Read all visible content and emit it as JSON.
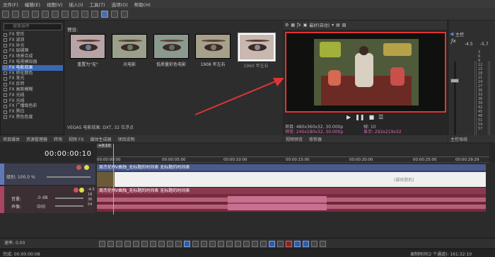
{
  "menu": [
    "文件(F)",
    "编辑(E)",
    "视图(V)",
    "插入(I)",
    "工具(T)",
    "选项(O)",
    "帮助(H)"
  ],
  "fx": {
    "search_placeholder": "搜索插件",
    "items": [
      "变形",
      "波浪",
      "补光",
      "层缝隙",
      "场景合成",
      "电视模拟器",
      "电影效果",
      "转化颜色",
      "发光",
      "反转",
      "高斯模糊",
      "光线",
      "光线",
      "广播级色彩",
      "黑白",
      "黑色色度"
    ],
    "selected_index": 6
  },
  "presets": {
    "label": "预设:",
    "items": [
      "重置为\"无\"",
      "光电影",
      "低质量彩色电影",
      "1908 年左右",
      "1960 年左右"
    ],
    "status": "VEGAS 电影效果: DXT, 32 位浮点"
  },
  "tabs": {
    "left": [
      "项目媒体",
      "资源管理器",
      "转场",
      "视频 FX",
      "媒体生成器",
      "项目说明"
    ],
    "preview": [
      "视频预览",
      "修剪器"
    ],
    "master": [
      "主控母线"
    ]
  },
  "preview": {
    "mode": "最好(自动)",
    "info_left": [
      "项目: 480x360x32, 30.000p",
      "预览: 240x180x32, 30.000p",
      "显示: 292x219x32"
    ],
    "info_right": [
      "帧:",
      "10"
    ],
    "pink_key": "预览: 240x180x32, 30.000p"
  },
  "master": {
    "title": "主控",
    "levels": [
      "-4.5",
      "-5.7"
    ],
    "scale": [
      "3",
      "6",
      "9",
      "12",
      "15",
      "18",
      "21",
      "24",
      "27",
      "30",
      "33",
      "36",
      "39",
      "42",
      "45",
      "48",
      "51",
      "54",
      "57"
    ]
  },
  "timeline": {
    "current_time": "00:00:00:10",
    "marker": "+0:10",
    "ruler_ticks": [
      "00:00:00:00",
      "00:00:05:00",
      "00:00:10:00",
      "00:00:15:00",
      "00:00:20:00",
      "00:00:25:00",
      "00:00:29:29"
    ],
    "video_track": {
      "label": "级别: 100.0 %",
      "clip_title": "周杰伦MV曲独_无标题的时间表 无标题的时间表",
      "media_offline": "(媒体脱机)"
    },
    "audio_track": {
      "volume_label": "音量:",
      "volume_value": ".0 dB",
      "pan_label": "声像:",
      "pan_value": "中间",
      "clip_title": "周杰伦MV曲独_无标题的时间表 无标题的时间表",
      "meter": [
        "-4.5",
        "18",
        "36",
        "54"
      ]
    },
    "rate_label": "速率:",
    "rate_value": "0.00"
  },
  "status": {
    "left": "完成: 00:00:00:08",
    "right": "录制时间(2 个通道): 161:32:10"
  }
}
